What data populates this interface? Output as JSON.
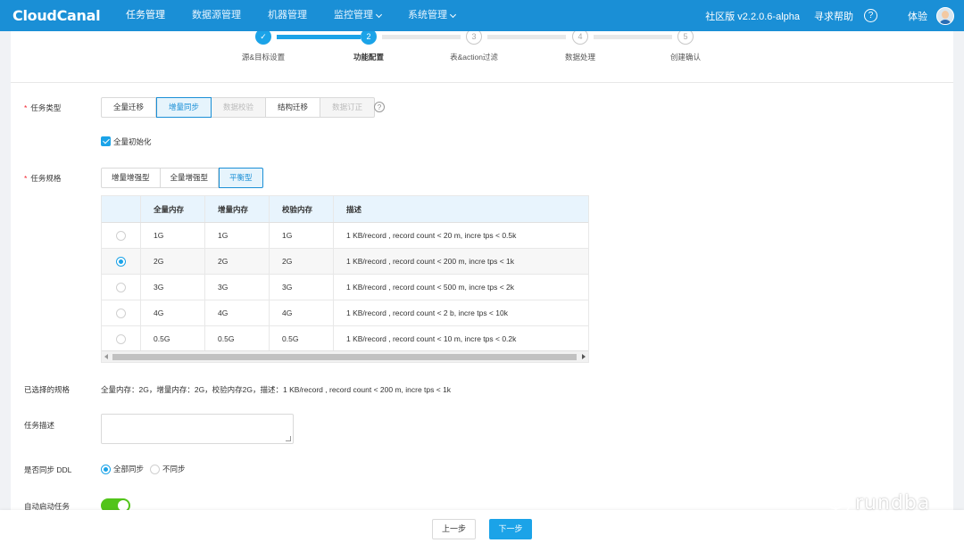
{
  "header": {
    "logo": "CloudCanal",
    "nav": [
      {
        "label": "任务管理",
        "active": true,
        "has_dropdown": false
      },
      {
        "label": "数据源管理",
        "active": false,
        "has_dropdown": false
      },
      {
        "label": "机器管理",
        "active": false,
        "has_dropdown": false
      },
      {
        "label": "监控管理",
        "active": false,
        "has_dropdown": true
      },
      {
        "label": "系统管理",
        "active": false,
        "has_dropdown": true
      }
    ],
    "version": "社区版 v2.2.0.6-alpha",
    "help": "寻求帮助",
    "help_icon": "?",
    "user": "体验"
  },
  "steps": [
    {
      "index": "1",
      "label": "源&目标设置",
      "status": "done",
      "icon": "check-icon"
    },
    {
      "index": "2",
      "label": "功能配置",
      "status": "active"
    },
    {
      "index": "3",
      "label": "表&action过滤",
      "status": "todo"
    },
    {
      "index": "4",
      "label": "数据处理",
      "status": "todo"
    },
    {
      "index": "5",
      "label": "创建确认",
      "status": "todo"
    }
  ],
  "task_type": {
    "label": "任务类型",
    "options": [
      {
        "label": "全量迁移",
        "state": "normal"
      },
      {
        "label": "增量同步",
        "state": "selected"
      },
      {
        "label": "数据校验",
        "state": "disabled"
      },
      {
        "label": "结构迁移",
        "state": "normal"
      },
      {
        "label": "数据订正",
        "state": "disabled"
      }
    ],
    "help_icon": "?",
    "checkbox_label": "全量初始化",
    "checkbox_checked": true
  },
  "task_spec": {
    "label": "任务规格",
    "options": [
      {
        "label": "增量增强型",
        "state": "normal"
      },
      {
        "label": "全量增强型",
        "state": "normal"
      },
      {
        "label": "平衡型",
        "state": "selected"
      }
    ],
    "columns": [
      "",
      "全量内存",
      "增量内存",
      "校验内存",
      "描述"
    ],
    "rows": [
      {
        "full": "1G",
        "incr": "1G",
        "check": "1G",
        "desc": "1 KB/record , record count < 20 m, incre tps < 0.5k",
        "selected": false
      },
      {
        "full": "2G",
        "incr": "2G",
        "check": "2G",
        "desc": "1 KB/record , record count < 200 m, incre tps < 1k",
        "selected": true
      },
      {
        "full": "3G",
        "incr": "3G",
        "check": "3G",
        "desc": "1 KB/record , record count < 500 m, incre tps < 2k",
        "selected": false
      },
      {
        "full": "4G",
        "incr": "4G",
        "check": "4G",
        "desc": "1 KB/record , record count < 2 b, incre tps < 10k",
        "selected": false
      },
      {
        "full": "0.5G",
        "incr": "0.5G",
        "check": "0.5G",
        "desc": "1 KB/record , record count < 10 m, incre tps < 0.2k",
        "selected": false
      }
    ]
  },
  "selected_spec": {
    "label": "已选择的规格",
    "value": "全量内存：2G，增量内存：2G，校验内存2G，描述：1 KB/record , record count < 200 m, incre tps < 1k"
  },
  "task_desc": {
    "label": "任务描述",
    "value": ""
  },
  "sync_ddl": {
    "label": "是否同步 DDL",
    "options": [
      {
        "label": "全部同步",
        "checked": true
      },
      {
        "label": "不同步",
        "checked": false
      }
    ]
  },
  "auto_start": {
    "label": "自动启动任务",
    "on": true
  },
  "footer": {
    "prev": "上一步",
    "next": "下一步"
  },
  "watermark": "rundba",
  "colors": {
    "primary": "#1ba3e8",
    "header": "#1a8fd6",
    "toggle_on": "#52c41a",
    "required": "#f5222d"
  }
}
